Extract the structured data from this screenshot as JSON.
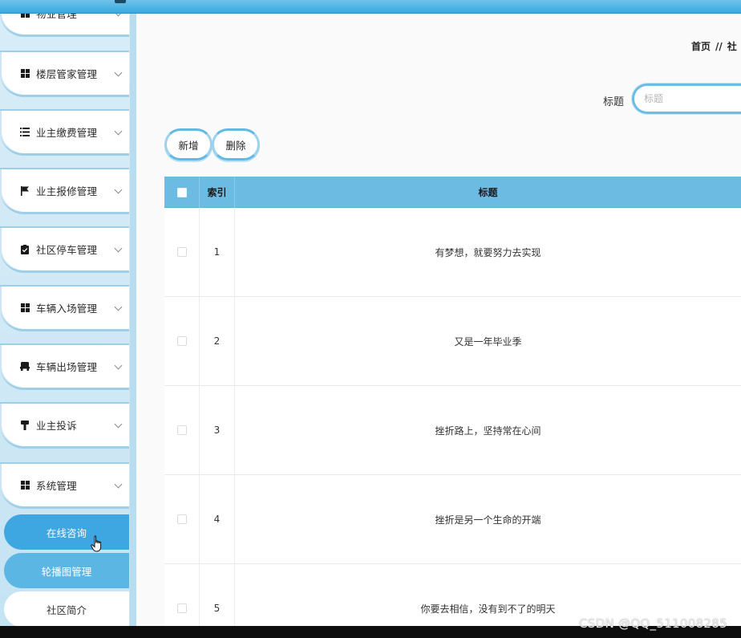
{
  "sidebar": {
    "items": [
      {
        "label": "物业管理",
        "icon": "grid-icon"
      },
      {
        "label": "楼层管家管理",
        "icon": "grid-icon"
      },
      {
        "label": "业主缴费管理",
        "icon": "list-icon"
      },
      {
        "label": "业主报修管理",
        "icon": "flag-icon"
      },
      {
        "label": "社区停车管理",
        "icon": "clipboard-check-icon"
      },
      {
        "label": "车辆入场管理",
        "icon": "grid-icon"
      },
      {
        "label": "车辆出场管理",
        "icon": "car-icon"
      },
      {
        "label": "业主投诉",
        "icon": "pin-icon"
      },
      {
        "label": "系统管理",
        "icon": "grid-icon"
      }
    ],
    "sub_items": [
      {
        "label": "在线咨询",
        "state": "active"
      },
      {
        "label": "轮播图管理",
        "state": "hover"
      },
      {
        "label": "社区简介",
        "state": "normal"
      }
    ]
  },
  "breadcrumb": {
    "home": "首页",
    "separator": "//",
    "current": "社"
  },
  "search": {
    "label": "标题",
    "placeholder": "标题"
  },
  "toolbar": {
    "add_label": "新增",
    "delete_label": "删除"
  },
  "table": {
    "headers": {
      "index": "索引",
      "title": "标题"
    },
    "rows": [
      {
        "index": "1",
        "title": "有梦想，就要努力去实现"
      },
      {
        "index": "2",
        "title": "又是一年毕业季"
      },
      {
        "index": "3",
        "title": "挫折路上，坚持常在心间"
      },
      {
        "index": "4",
        "title": "挫折是另一个生命的开端"
      },
      {
        "index": "5",
        "title": "你要去相信，没有到不了的明天"
      }
    ]
  },
  "watermark": "CSDN @QQ_511008285",
  "colors": {
    "accent": "#3ea6e0",
    "header_bg": "#6cbbe3",
    "sidebar_bg": "#d7edf8"
  }
}
